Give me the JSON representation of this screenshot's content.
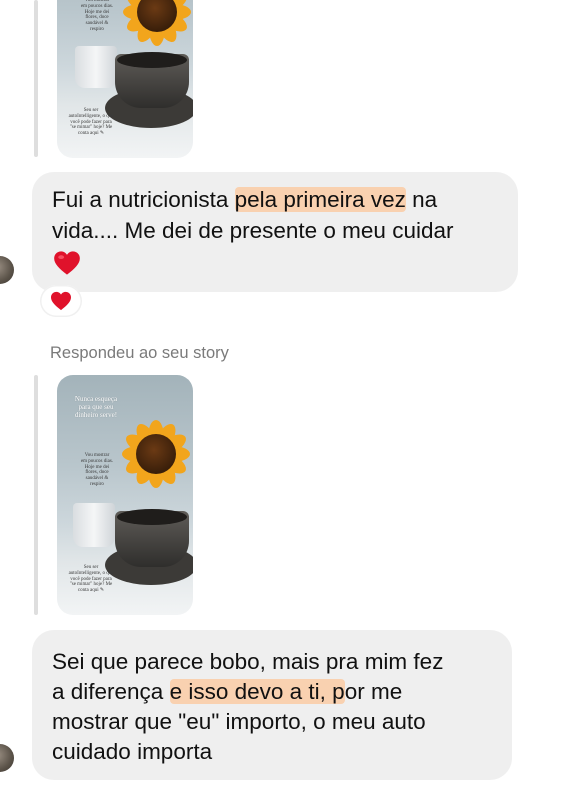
{
  "thread": {
    "reply_label": "Respondeu ao seu story",
    "story_top": {
      "small_caption_1": "Vou mostrar\nem poucos dias.\nHoje me dei\nflores, doce\nsaudável &\nrespiro",
      "small_caption_2": "Seu ser\nautoIntelligente, o que\nvocê pode fazer para\n\"se mimar\" hoje? Me\nconta aqui ✎"
    },
    "message_1": {
      "before": "Fui a nutricionista ",
      "highlight": "pela primeira vez",
      "after": " na",
      "line2": "vida.... Me dei de presente o meu cuidar",
      "emoji": "heart-emoji"
    },
    "reaction": "heart-emoji",
    "story_bottom": {
      "headline": "Nunca esqueça\npara que seu\ndinheiro serve!",
      "small_caption_1": "Vou mostrar\nem poucos dias.\nHoje me dei\nflores, doce\nsaudável &\nrespiro",
      "small_caption_2": "Seu ser\nautoIntelligente, o que\nvocê pode fazer para\n\"se mimar\" hoje? Me\nconta aqui ✎"
    },
    "message_2": {
      "line1": "Sei que parece bobo, mais pra mim fez",
      "line2_before": "a diferença ",
      "line2_highlight": "e isso devo a ti, p",
      "line2_after": "or me",
      "line3": "mostrar que \"eu\" importo, o meu auto",
      "line4": "cuidado importa"
    },
    "colors": {
      "bubble": "#efefef",
      "highlight": "#f9d1b0",
      "heart": "#e0122b",
      "muted_text": "#7a7a7a"
    }
  }
}
